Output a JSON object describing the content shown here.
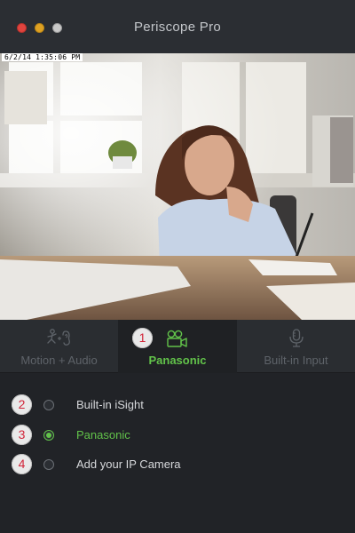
{
  "window": {
    "title": "Periscope Pro",
    "controls": [
      "close",
      "minimize",
      "zoom"
    ]
  },
  "camera": {
    "timestamp": "6/2/14 1:35:06 PM"
  },
  "tabs": [
    {
      "label": "Motion + Audio",
      "icon": "motion-audio-icon",
      "selected": false
    },
    {
      "label": "Panasonic",
      "icon": "camera-icon",
      "selected": true,
      "callout": "1"
    },
    {
      "label": "Built-in Input",
      "icon": "microphone-icon",
      "selected": false
    }
  ],
  "sources": [
    {
      "label": "Built-in iSight",
      "selected": false,
      "callout": "2"
    },
    {
      "label": "Panasonic",
      "selected": true,
      "callout": "3"
    },
    {
      "label": "Add your IP Camera",
      "selected": false,
      "callout": "4"
    }
  ],
  "colors": {
    "accent": "#62c34a",
    "callout_text": "#d2263a",
    "background": "#212327"
  }
}
